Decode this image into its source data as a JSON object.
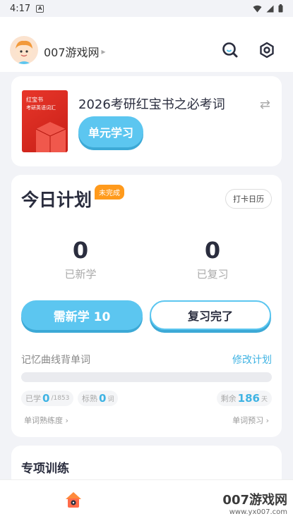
{
  "status_bar": {
    "time": "4:17",
    "box_letter": "A"
  },
  "header": {
    "username": "007游戏网"
  },
  "book": {
    "cover_line1": "红宝书",
    "cover_line2": "考研英语词汇",
    "title": "2026考研红宝书之必考词",
    "unit_button": "单元学习"
  },
  "plan": {
    "title": "今日计划",
    "badge": "未完成",
    "checkin": "打卡日历",
    "new_count": "0",
    "new_label": "已新学",
    "review_count": "0",
    "review_label": "已复习",
    "btn_new": "需新学 10",
    "btn_review": "复习完了",
    "curve_title": "记忆曲线背单词",
    "modify": "修改计划",
    "progress": 0,
    "learned_label": "已学",
    "learned_num": "0",
    "learned_total": "/1853",
    "marked_label": "标熟",
    "marked_num": "0",
    "marked_unit": "词",
    "remain_label": "剩余",
    "remain_num": "186",
    "remain_unit": "天",
    "proficiency": "单词熟练度",
    "preview": "单词预习"
  },
  "special": {
    "title": "专项训练"
  },
  "watermark": {
    "main": "007游戏网",
    "sub": "www.yx007.com"
  }
}
